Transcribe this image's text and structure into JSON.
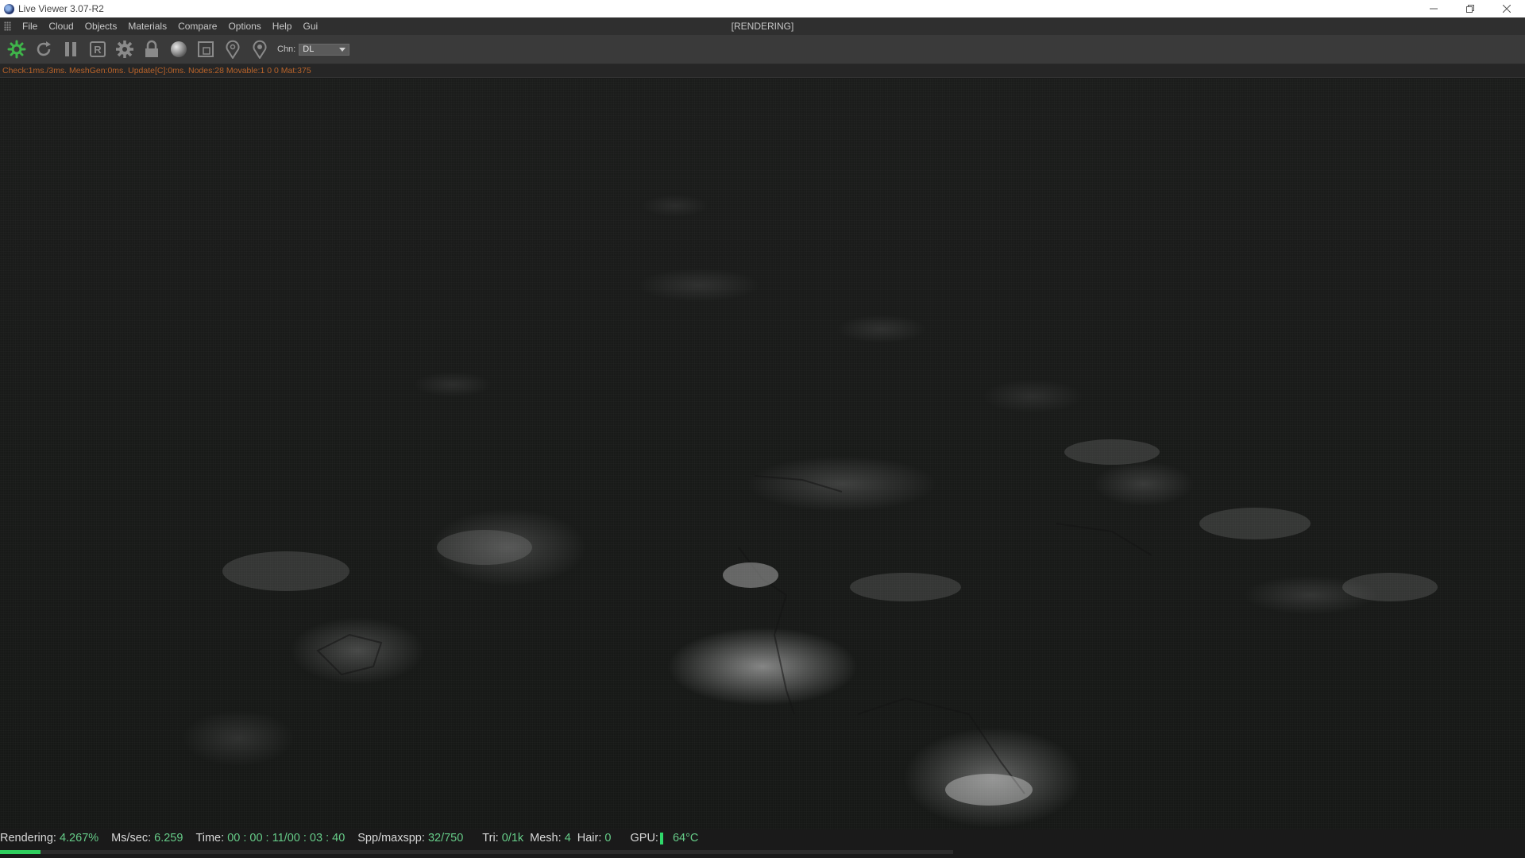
{
  "window": {
    "title": "Live Viewer 3.07-R2",
    "controls": [
      "minimize",
      "restore",
      "close"
    ]
  },
  "menu": {
    "items": [
      "File",
      "Cloud",
      "Objects",
      "Materials",
      "Compare",
      "Options",
      "Help",
      "Gui"
    ],
    "state": "[RENDERING]"
  },
  "toolbar": {
    "buttons": [
      "start-render-icon",
      "refresh-icon",
      "pause-icon",
      "region-render-icon",
      "settings-gear-icon",
      "lock-icon",
      "material-ball-icon",
      "clay-mode-icon",
      "pick-focus-icon",
      "pick-material-icon"
    ],
    "channel_label": "Chn:",
    "channel_value": "DL"
  },
  "info_line": "Check:1ms./3ms. MeshGen:0ms. Update[C]:0ms. Nodes:28 Movable:1  0 0 Mat:375",
  "status": {
    "rendering_label": "Rendering:",
    "rendering_value": "4.267%",
    "progress": 0.04267,
    "ms_label": "Ms/sec:",
    "ms_value": "6.259",
    "time_label": "Time:",
    "time_value": "00 : 00 : 11/00 : 03 : 40",
    "spp_label": "Spp/maxspp:",
    "spp_value": "32/750",
    "tri_label": "Tri:",
    "tri_value": "0/1k",
    "mesh_label": "Mesh:",
    "mesh_value": "4",
    "hair_label": "Hair:",
    "hair_value": "0",
    "gpu_label": "GPU:",
    "gpu_temp": "64°C",
    "accent_color": "#66cc88",
    "progress_color": "#2fce5e"
  }
}
